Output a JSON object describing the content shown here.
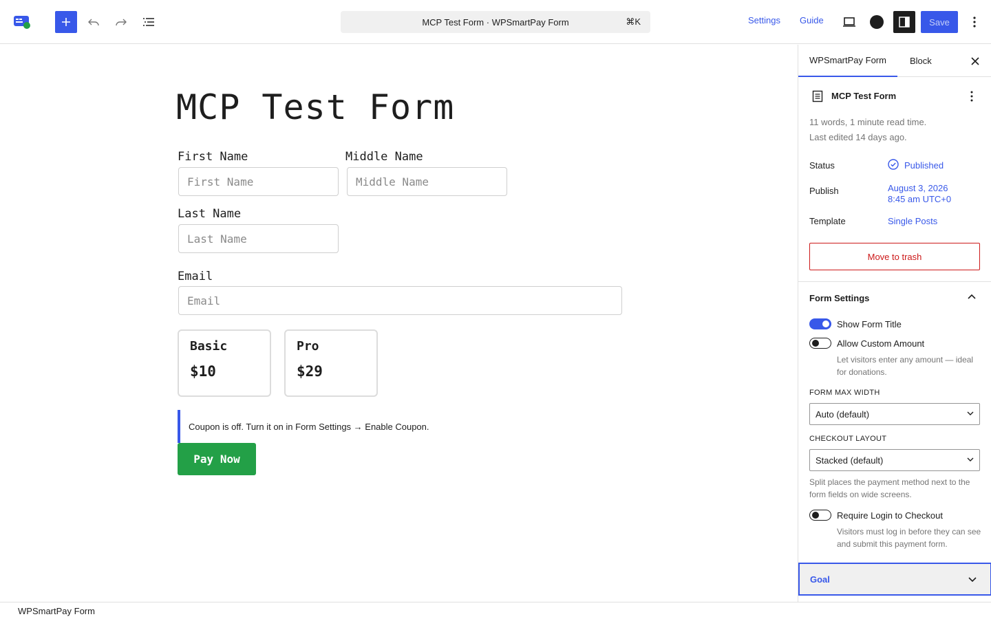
{
  "toolbar": {
    "command_title": "MCP Test Form · WPSmartPay Form",
    "shortcut": "⌘K",
    "settings_label": "Settings",
    "guide_label": "Guide",
    "save_label": "Save",
    "accent_color": "#3858e9"
  },
  "form": {
    "title": "MCP Test Form",
    "fields": {
      "first_name": {
        "label": "First Name",
        "placeholder": "First Name"
      },
      "middle_name": {
        "label": "Middle Name",
        "placeholder": "Middle Name"
      },
      "last_name": {
        "label": "Last Name",
        "placeholder": "Last Name"
      },
      "email": {
        "label": "Email",
        "placeholder": "Email"
      }
    },
    "plans": [
      {
        "name": "Basic",
        "price": "$10"
      },
      {
        "name": "Pro",
        "price": "$29"
      }
    ],
    "notice": "Coupon is off. Turn it on in Form Settings → Enable Coupon.",
    "pay_label": "Pay Now",
    "pay_color": "#23a047"
  },
  "sidebar": {
    "tabs": [
      "WPSmartPay Form",
      "Block"
    ],
    "active_tab": "WPSmartPay Form",
    "doc_title": "MCP Test Form",
    "meta_words": "11 words, 1 minute read time.",
    "meta_edited": "Last edited 14 days ago.",
    "status_label": "Status",
    "status_value": "Published",
    "publish_label": "Publish",
    "publish_date": "August 3, 2026",
    "publish_time": "8:45 am UTC+0",
    "template_label": "Template",
    "template_value": "Single Posts",
    "trash_label": "Move to trash",
    "form_settings": {
      "title": "Form Settings",
      "show_title_label": "Show Form Title",
      "show_title_on": true,
      "custom_amount_label": "Allow Custom Amount",
      "custom_amount_on": false,
      "custom_amount_help": "Let visitors enter any amount — ideal for donations.",
      "max_width_label": "Form max width",
      "max_width_value": "Auto (default)",
      "layout_label": "Checkout layout",
      "layout_value": "Stacked (default)",
      "layout_help": "Split places the payment method next to the form fields on wide screens.",
      "require_login_label": "Require Login to Checkout",
      "require_login_on": false,
      "require_login_help": "Visitors must log in before they can see and submit this payment form."
    },
    "goal_label": "Goal"
  },
  "footer": {
    "breadcrumb": "WPSmartPay Form"
  }
}
